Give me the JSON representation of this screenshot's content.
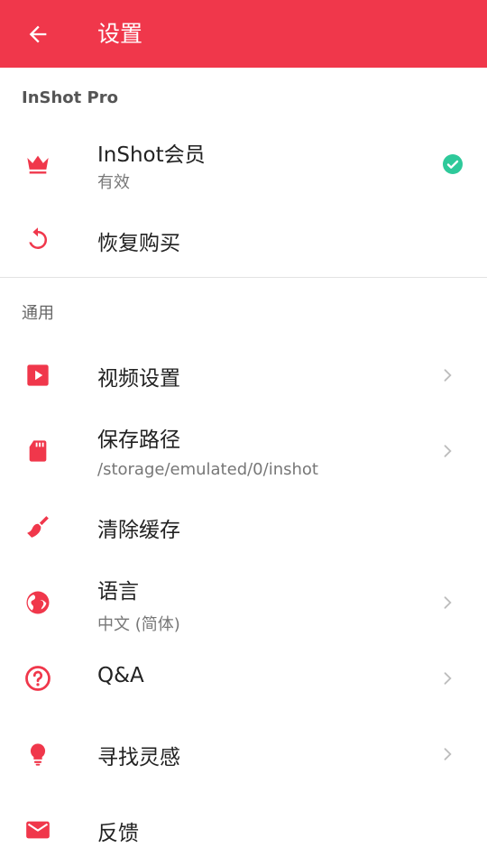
{
  "appbar": {
    "title": "设置"
  },
  "colors": {
    "accent": "#f0374b",
    "check": "#2ec99a",
    "chevron": "#bdbdbd"
  },
  "pro_section": {
    "header": "InShot Pro",
    "membership": {
      "label": "InShot会员",
      "status": "有效",
      "icon": "crown-icon"
    },
    "restore": {
      "label": "恢复购买",
      "icon": "restore-icon"
    }
  },
  "general_section": {
    "header": "通用",
    "items": [
      {
        "label": "视频设置",
        "icon": "video-icon"
      },
      {
        "label": "保存路径",
        "sub": "/storage/emulated/0/inshot",
        "icon": "sd-card-icon"
      },
      {
        "label": "清除缓存",
        "icon": "broom-icon"
      },
      {
        "label": "语言",
        "sub": "中文 (简体)",
        "icon": "globe-icon"
      },
      {
        "label": "Q&A",
        "icon": "help-circle-icon"
      },
      {
        "label": "寻找灵感",
        "icon": "lightbulb-icon"
      },
      {
        "label": "反馈",
        "icon": "mail-icon"
      }
    ]
  }
}
